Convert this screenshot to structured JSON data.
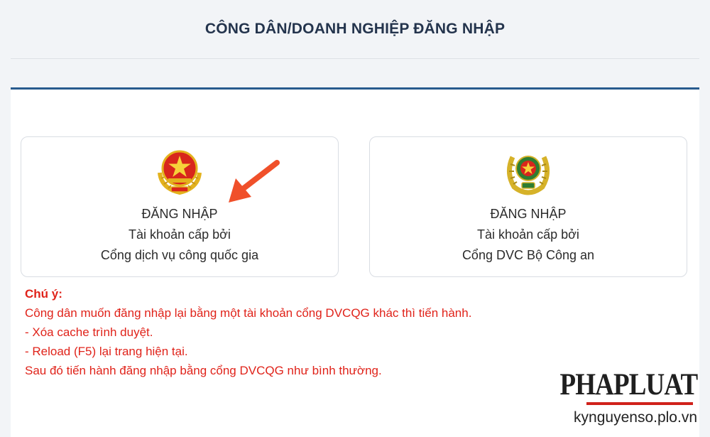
{
  "header": {
    "title": "CÔNG DÂN/DOANH NGHIỆP ĐĂNG NHẬP"
  },
  "cards": [
    {
      "line1": "ĐĂNG NHẬP",
      "line2": "Tài khoản cấp bởi",
      "line3": "Cổng dịch vụ công quốc gia"
    },
    {
      "line1": "ĐĂNG NHẬP",
      "line2": "Tài khoản cấp bởi",
      "line3": "Cổng DVC Bộ Công an"
    }
  ],
  "notice": {
    "title": "Chú ý:",
    "lines": [
      "Công dân muốn đăng nhập lại bằng một tài khoản cổng DVCQG khác thì tiến hành.",
      "- Xóa cache trình duyệt.",
      "- Reload (F5) lại trang hiện tại.",
      "Sau đó tiến hành đăng nhập bằng cổng DVCQG như bình thường."
    ]
  },
  "watermark": {
    "logo": "PHAPLUAT",
    "url": "kynguyenso.plo.vn"
  },
  "icons": {
    "left_card": "national-emblem-icon",
    "right_card": "police-emblem-icon",
    "annotation": "red-arrow-icon"
  },
  "colors": {
    "header_text": "#24344d",
    "panel_accent": "#285b8e",
    "notice_text": "#e0231a",
    "arrow": "#f0502a"
  }
}
